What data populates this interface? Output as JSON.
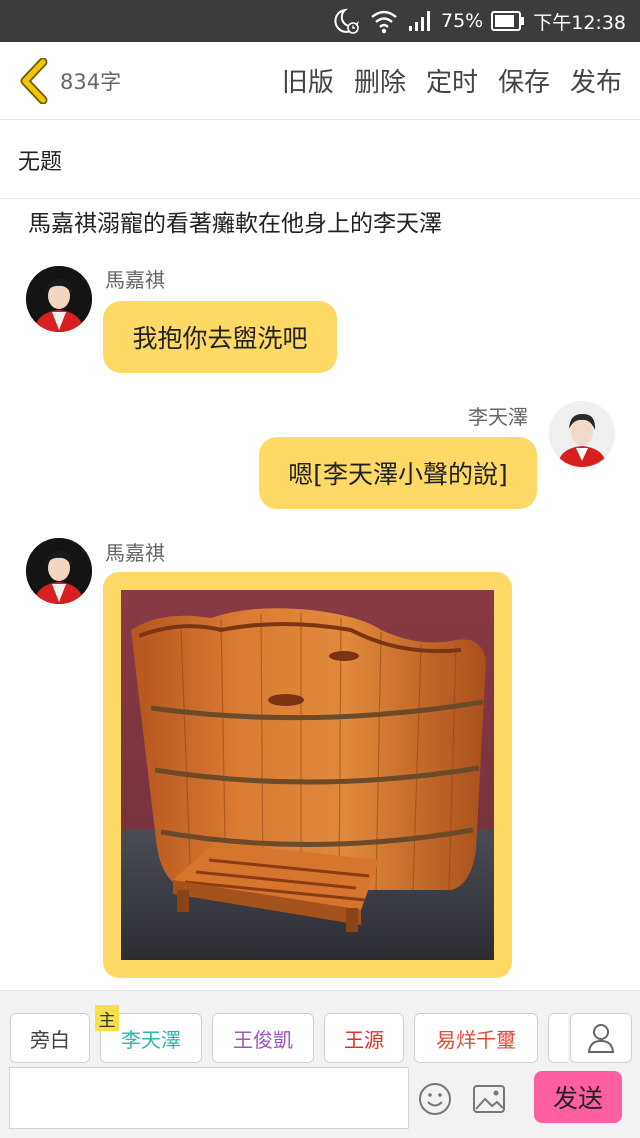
{
  "status_bar": {
    "battery": "75%",
    "time": "下午12:38"
  },
  "toolbar": {
    "word_count": "834字",
    "actions": [
      "旧版",
      "删除",
      "定时",
      "保存",
      "发布"
    ]
  },
  "story": {
    "title": "无题",
    "narration": "馬嘉祺溺寵的看著癱軟在他身上的李天澤"
  },
  "messages": [
    {
      "speaker": "馬嘉祺",
      "text": "我抱你去盥洗吧",
      "side": "left"
    },
    {
      "speaker": "李天澤",
      "text": "嗯[李天澤小聲的說]",
      "side": "right"
    },
    {
      "speaker": "馬嘉祺",
      "image": "wooden-bathtub",
      "side": "left"
    }
  ],
  "composer": {
    "characters": [
      {
        "label": "旁白",
        "color": "#444444"
      },
      {
        "label": "李天澤",
        "color": "#2ab7a9",
        "main": "主"
      },
      {
        "label": "王俊凱",
        "color": "#9b59b6"
      },
      {
        "label": "王源",
        "color": "#e0302a"
      },
      {
        "label": "易烊千璽",
        "color": "#e04a3a"
      }
    ],
    "input_value": "",
    "send_label": "发送"
  },
  "colors": {
    "bubble": "#ffd966",
    "send": "#ff5fa0",
    "back_arrow": "#e6b800"
  }
}
